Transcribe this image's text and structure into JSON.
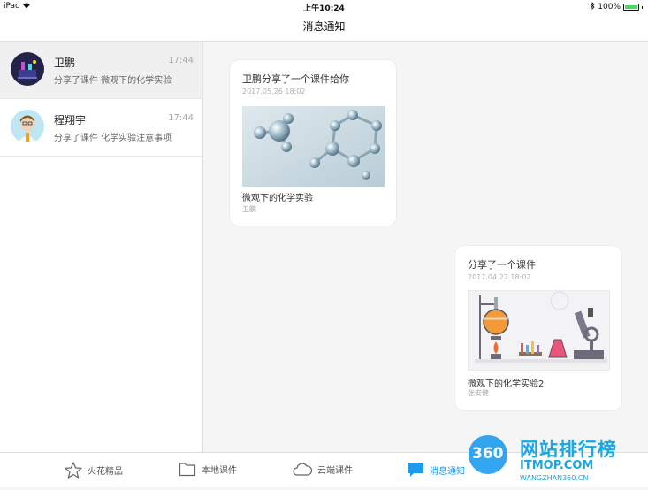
{
  "status_bar": {
    "device": "iPad",
    "time": "上午10:24",
    "battery": "100%"
  },
  "nav": {
    "title": "消息通知"
  },
  "conversations": [
    {
      "name": "卫鹏",
      "time": "17:44",
      "preview": "分享了课件 微观下的化学实验",
      "active": true
    },
    {
      "name": "程翔宇",
      "time": "17:44",
      "preview": "分享了课件 化学实验注意事项",
      "active": false
    }
  ],
  "messages": [
    {
      "title": "卫鹏分享了一个课件给你",
      "date": "2017.05.26 18:02",
      "course": "微观下的化学实验",
      "author": "卫鹏",
      "thumb_icon": "molecule-image"
    },
    {
      "title": "分享了一个课件",
      "date": "2017.04.22 18:02",
      "course": "微观下的化学实验2",
      "author": "张安健",
      "thumb_icon": "lab-equipment-image"
    }
  ],
  "tabs": [
    {
      "label": "火花精品",
      "icon": "star-icon",
      "active": false
    },
    {
      "label": "本地课件",
      "icon": "folder-icon",
      "active": false
    },
    {
      "label": "云端课件",
      "icon": "cloud-icon",
      "active": false
    },
    {
      "label": "消息通知",
      "icon": "message-icon",
      "active": true
    }
  ],
  "watermark": {
    "badge": "360",
    "text": "网站排行榜",
    "site": "ITMOP.COM",
    "sub": "WANGZHAN360.CN"
  },
  "colors": {
    "accent": "#1e9bf0",
    "background": "#f5f5f6"
  }
}
